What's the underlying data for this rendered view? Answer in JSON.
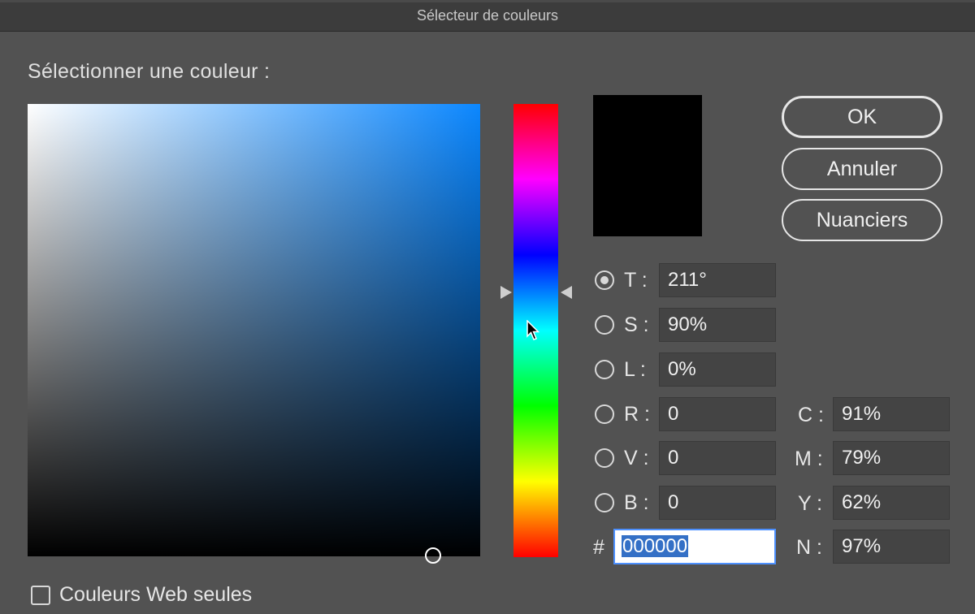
{
  "window": {
    "title": "Sélecteur de couleurs"
  },
  "prompt": "Sélectionner une couleur :",
  "buttons": {
    "ok": "OK",
    "cancel": "Annuler",
    "swatches": "Nuanciers"
  },
  "color_model": {
    "selected": "T",
    "hsl": [
      {
        "label": "T :",
        "value": "211°"
      },
      {
        "label": "S :",
        "value": "90%"
      },
      {
        "label": "L :",
        "value": "0%"
      }
    ],
    "rgb": [
      {
        "label": "R :",
        "value": "0"
      },
      {
        "label": "V :",
        "value": "0"
      },
      {
        "label": "B :",
        "value": "0"
      }
    ],
    "cmyk": [
      {
        "label": "C :",
        "value": "91%"
      },
      {
        "label": "M :",
        "value": "79%"
      },
      {
        "label": "Y :",
        "value": "62%"
      },
      {
        "label": "N :",
        "value": "97%"
      }
    ],
    "hex": {
      "label": "#",
      "value": "000000"
    }
  },
  "web_colors_only": {
    "label": "Couleurs Web seules",
    "checked": false
  },
  "colors": {
    "current": "#000000",
    "field_hue": "#0b87ff"
  },
  "icons": [
    "radio-selected",
    "radio",
    "cursor",
    "checkbox"
  ]
}
